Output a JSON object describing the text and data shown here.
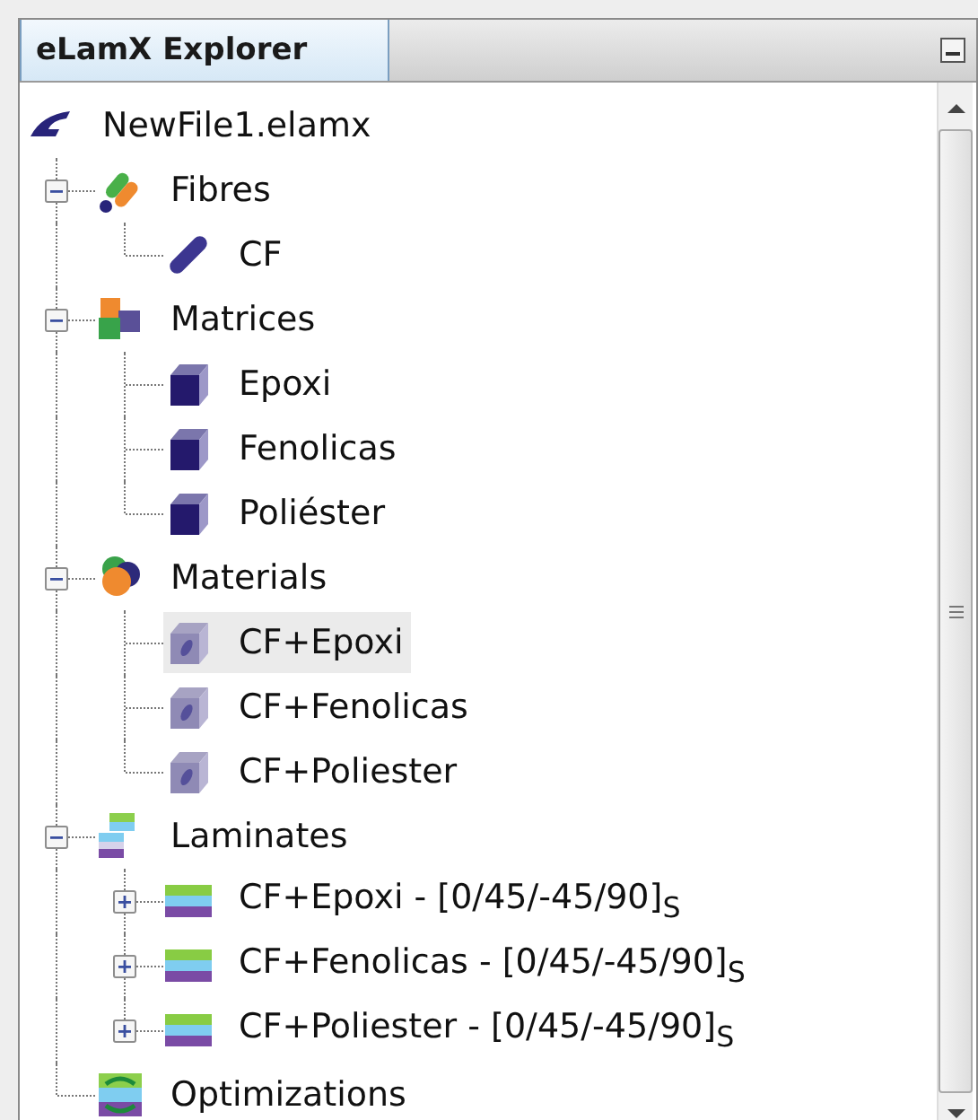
{
  "panel": {
    "title": "eLamX Explorer"
  },
  "tree": {
    "label": "NewFile1.elamx",
    "kind": "file",
    "selected": false,
    "children": [
      {
        "label": "Fibres",
        "kind": "fibres",
        "expanded": true,
        "selected": false,
        "children": [
          {
            "label": "CF",
            "kind": "fibre",
            "selected": false
          }
        ]
      },
      {
        "label": "Matrices",
        "kind": "matrices",
        "expanded": true,
        "selected": false,
        "children": [
          {
            "label": "Epoxi",
            "kind": "matrix",
            "selected": false
          },
          {
            "label": "Fenolicas",
            "kind": "matrix",
            "selected": false
          },
          {
            "label": "Poliéster",
            "kind": "matrix",
            "selected": false
          }
        ]
      },
      {
        "label": "Materials",
        "kind": "materials",
        "expanded": true,
        "selected": false,
        "children": [
          {
            "label": "CF+Epoxi",
            "kind": "material",
            "selected": true
          },
          {
            "label": "CF+Fenolicas",
            "kind": "material",
            "selected": false
          },
          {
            "label": "CF+Poliester",
            "kind": "material",
            "selected": false
          }
        ]
      },
      {
        "label": "Laminates",
        "kind": "laminates",
        "expanded": true,
        "selected": false,
        "children": [
          {
            "label": "CF+Epoxi - [0/45/-45/90]$_{S}$",
            "kind": "laminate",
            "expanded": false,
            "selected": false
          },
          {
            "label": "CF+Fenolicas - [0/45/-45/90]$_{S}$",
            "kind": "laminate",
            "expanded": false,
            "selected": false
          },
          {
            "label": "CF+Poliester - [0/45/-45/90]$_{S}$",
            "kind": "laminate",
            "expanded": false,
            "selected": false
          }
        ]
      },
      {
        "label": "Optimizations",
        "kind": "optimizations",
        "selected": false
      }
    ]
  }
}
